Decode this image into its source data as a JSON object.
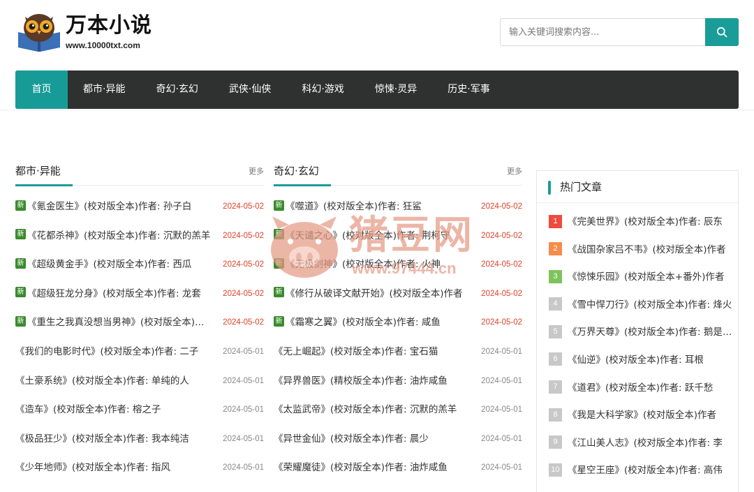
{
  "site": {
    "brand": "万本小说",
    "url": "www.10000txt.com"
  },
  "search": {
    "placeholder": "输入关键词搜索内容...",
    "icon": "search-icon"
  },
  "nav": {
    "items": [
      {
        "label": "首页",
        "active": true
      },
      {
        "label": "都市·异能"
      },
      {
        "label": "奇幻·玄幻"
      },
      {
        "label": "武侠·仙侠"
      },
      {
        "label": "科幻·游戏"
      },
      {
        "label": "惊悚·灵异"
      },
      {
        "label": "历史·军事"
      }
    ]
  },
  "columns": [
    {
      "title": "都市·异能",
      "more": "更多",
      "items": [
        {
          "new": "新",
          "title": "《氪金医生》(校对版全本)作者: 孙子白",
          "date": "2024-05-02"
        },
        {
          "new": "新",
          "title": "《花都杀神》(校对版全本)作者: 沉默的羔羊",
          "date": "2024-05-02"
        },
        {
          "new": "新",
          "title": "《超级黄金手》(校对版全本)作者: 西瓜",
          "date": "2024-05-02"
        },
        {
          "new": "新",
          "title": "《超级狂龙分身》(校对版全本)作者: 龙套",
          "date": "2024-05-02"
        },
        {
          "new": "新",
          "title": "《重生之我真没想当男神》(校对版全本)作者",
          "date": "2024-05-02"
        },
        {
          "title": "《我们的电影时代》(校对版全本)作者: 二子",
          "date": "2024-05-01"
        },
        {
          "title": "《土豪系统》(校对版全本)作者: 单纯的人",
          "date": "2024-05-01"
        },
        {
          "title": "《造车》(校对版全本)作者: 榕之子",
          "date": "2024-05-01"
        },
        {
          "title": "《极品狂少》(校对版全本)作者: 我本纯洁",
          "date": "2024-05-01"
        },
        {
          "title": "《少年地师》(校对版全本)作者: 指风",
          "date": "2024-05-01"
        }
      ]
    },
    {
      "title": "奇幻·玄幻",
      "more": "更多",
      "items": [
        {
          "new": "新",
          "title": "《噬道》(校对版全本)作者: 狂鲨",
          "date": "2024-05-02"
        },
        {
          "new": "新",
          "title": "《天谴之心》(校对版全本)作者: 荆柯守",
          "date": "2024-05-02"
        },
        {
          "new": "新",
          "title": "《无极剑神》(校对版全本)作者: 火神",
          "date": "2024-05-02"
        },
        {
          "new": "新",
          "title": "《修行从破译文献开始》(校对版全本)作者",
          "date": "2024-05-02"
        },
        {
          "new": "新",
          "title": "《霜寒之翼》(校对版全本)作者: 咸鱼",
          "date": "2024-05-02"
        },
        {
          "title": "《无上崛起》(校对版全本)作者: 宝石猫",
          "date": "2024-05-01"
        },
        {
          "title": "《异界兽医》(精校版全本)作者: 油炸咸鱼",
          "date": "2024-05-01"
        },
        {
          "title": "《太监武帝》(校对版全本)作者: 沉默的羔羊",
          "date": "2024-05-01"
        },
        {
          "title": "《异世金仙》(校对版全本)作者: 晨少",
          "date": "2024-05-01"
        },
        {
          "title": "《荣耀魔徒》(校对版全本)作者: 油炸咸鱼",
          "date": "2024-05-01"
        }
      ]
    }
  ],
  "hot": {
    "title": "热门文章",
    "colors": {
      "rank1": "#ef4a3d",
      "rank2": "#f58c4b",
      "rank3": "#7dc35b",
      "other": "#c8c8c8"
    },
    "items": [
      {
        "rank": "1",
        "title": "《完美世界》(校对版全本)作者: 辰东"
      },
      {
        "rank": "2",
        "title": "《战国杂家吕不韦》(校对版全本)作者"
      },
      {
        "rank": "3",
        "title": "《惊悚乐园》(校对版全本+番外)作者"
      },
      {
        "rank": "4",
        "title": "《雪中悍刀行》(校对版全本)作者: 烽火"
      },
      {
        "rank": "5",
        "title": "《万界天尊》(校对版全本)作者: 鹅是老五"
      },
      {
        "rank": "6",
        "title": "《仙逆》(校对版全本)作者: 耳根"
      },
      {
        "rank": "7",
        "title": "《道君》(校对版全本)作者: 跃千愁"
      },
      {
        "rank": "8",
        "title": "《我是大科学家》(校对版全本)作者"
      },
      {
        "rank": "9",
        "title": "《江山美人志》(校对版全本)作者: 李"
      },
      {
        "rank": "10",
        "title": "《星空王座》(校对版全本)作者: 高伟"
      }
    ]
  },
  "watermark": {
    "text": "猪豆网",
    "url": "www.97444.cn"
  }
}
